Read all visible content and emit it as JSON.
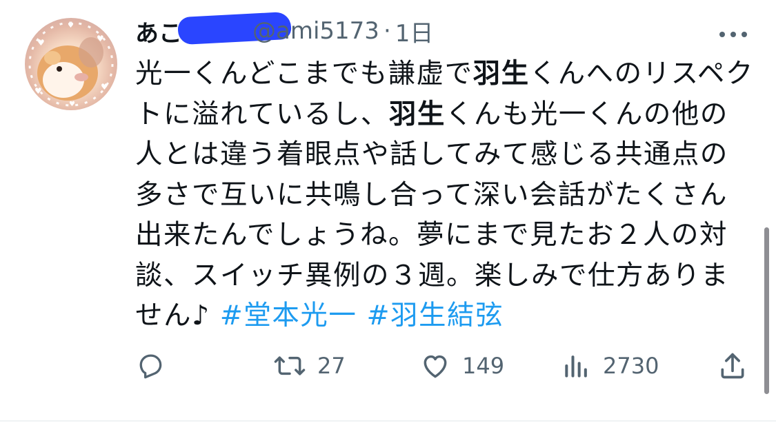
{
  "tweet": {
    "display_name": "あこ",
    "handle": "@ami5173",
    "separator": "·",
    "time": "1日",
    "body": [
      {
        "type": "text",
        "text": "光一くんどこまでも謙虚で"
      },
      {
        "type": "bold",
        "text": "羽生"
      },
      {
        "type": "text",
        "text": "くんへのリスペクトに溢れているし、"
      },
      {
        "type": "bold",
        "text": "羽生"
      },
      {
        "type": "text",
        "text": "くんも光一くんの他の人とは違う着眼点や話してみて感じる共通点の多さで互いに共鳴し合って深い会話がたくさん出来たんでしょうね。夢にまで見たお２人の対談、スイッチ異例の３週。楽しみで仕方ありません♪ "
      },
      {
        "type": "hashtag",
        "text": "#堂本光一"
      },
      {
        "type": "text",
        "text": " "
      },
      {
        "type": "hashtag",
        "text": "#羽生結弦"
      }
    ],
    "actions": {
      "reply_icon": "reply-icon",
      "retweet_icon": "retweet-icon",
      "retweet_count": "27",
      "like_icon": "heart-icon",
      "like_count": "149",
      "views_icon": "views-chart-icon",
      "views_count": "2730",
      "share_icon": "share-icon"
    },
    "more_icon": "more-options-icon"
  },
  "colors": {
    "text": "#0f1419",
    "secondary": "#536471",
    "link": "#1d9bf0",
    "redaction": "#1f3bff"
  }
}
